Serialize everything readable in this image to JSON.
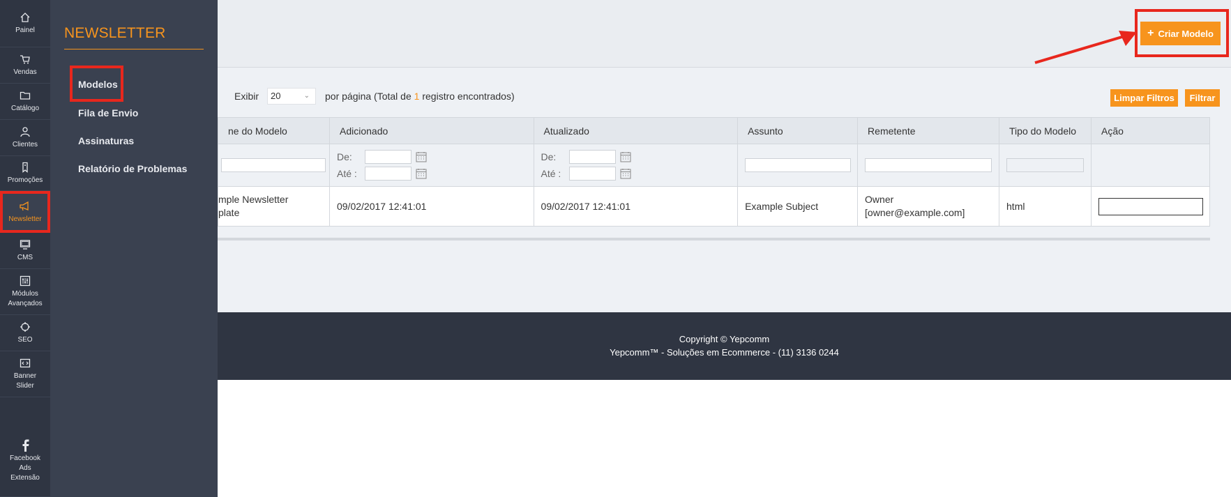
{
  "rail": [
    {
      "label": "Painel",
      "icon": "home-icon"
    },
    {
      "label": "Vendas",
      "icon": "cart-icon"
    },
    {
      "label": "Catálogo",
      "icon": "folder-icon"
    },
    {
      "label": "Clientes",
      "icon": "user-icon"
    },
    {
      "label": "Promoções",
      "icon": "tag-icon"
    },
    {
      "label": "Newsletter",
      "icon": "megaphone-icon",
      "active": true
    },
    {
      "label": "CMS",
      "icon": "monitor-icon"
    },
    {
      "label": "Módulos Avançados",
      "icon": "sliders-icon"
    },
    {
      "label": "SEO",
      "icon": "crosshair-icon"
    },
    {
      "label": "Banner Slider",
      "icon": "code-window-icon"
    },
    {
      "label": "Facebook Ads Extensão",
      "icon": "facebook-icon"
    }
  ],
  "submenu": {
    "title": "NEWSLETTER",
    "items": [
      "Modelos",
      "Fila de Envio",
      "Assinaturas",
      "Relatório de Problemas"
    ]
  },
  "toolbar": {
    "create_label": "Criar Modelo"
  },
  "pager": {
    "show_label": "Exibir",
    "per_page_value": "20",
    "per_page_text": "por página (Total de",
    "total_count": "1",
    "found_text": "registro encontrados)"
  },
  "filters": {
    "clear_label": "Limpar Filtros",
    "filter_label": "Filtrar",
    "from_label": "De:",
    "to_label": "Até :"
  },
  "table": {
    "columns": [
      "ne do Modelo",
      "Adicionado",
      "Atualizado",
      "Assunto",
      "Remetente",
      "Tipo do Modelo",
      "Ação"
    ],
    "rows": [
      {
        "name_line1": "mple Newsletter",
        "name_line2": "plate",
        "added": "09/02/2017 12:41:01",
        "updated": "09/02/2017 12:41:01",
        "subject": "Example Subject",
        "sender_line1": "Owner",
        "sender_line2": "[owner@example.com]",
        "type": "html"
      }
    ]
  },
  "footer": {
    "copyright": "Copyright © Yepcomm",
    "company": "Yepcomm™ - Soluções em Ecommerce - (11) 3136 0244"
  },
  "colors": {
    "accent": "#f7941d",
    "highlight": "#e8271d",
    "sidebar": "#2f3542"
  }
}
